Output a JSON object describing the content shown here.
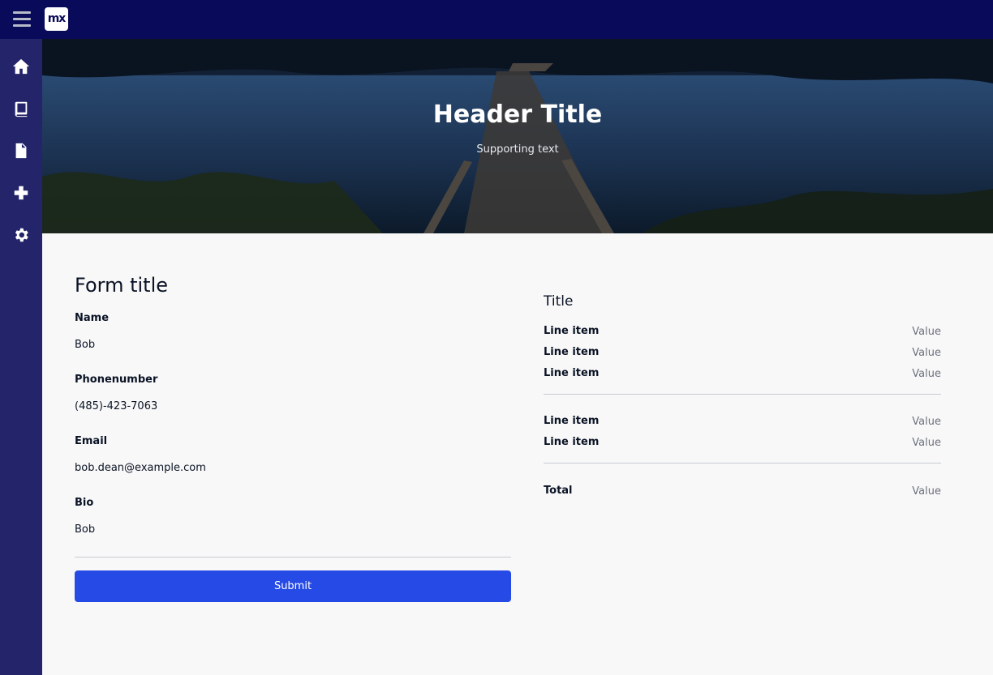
{
  "app": {
    "logo_text": "mx"
  },
  "sidebar": {
    "items": [
      {
        "icon": "home-icon"
      },
      {
        "icon": "book-icon"
      },
      {
        "icon": "file-icon"
      },
      {
        "icon": "plus-icon"
      },
      {
        "icon": "gear-icon"
      }
    ]
  },
  "header": {
    "title": "Header Title",
    "subtitle": "Supporting text"
  },
  "form": {
    "title": "Form title",
    "fields": [
      {
        "label": "Name",
        "value": "Bob"
      },
      {
        "label": "Phonenumber",
        "value": "(485)-423-7063"
      },
      {
        "label": "Email",
        "value": "bob.dean@example.com"
      },
      {
        "label": "Bio",
        "value": "Bob"
      }
    ],
    "submit_label": "Submit"
  },
  "summary": {
    "title": "Title",
    "group1": [
      {
        "label": "Line item",
        "value": "Value"
      },
      {
        "label": "Line item",
        "value": "Value"
      },
      {
        "label": "Line item",
        "value": "Value"
      }
    ],
    "group2": [
      {
        "label": "Line item",
        "value": "Value"
      },
      {
        "label": "Line item",
        "value": "Value"
      }
    ],
    "total": {
      "label": "Total",
      "value": "Value"
    }
  },
  "colors": {
    "topbar": "#0a0a5a",
    "sidebar": "#24246b",
    "accent": "#264ae5"
  }
}
